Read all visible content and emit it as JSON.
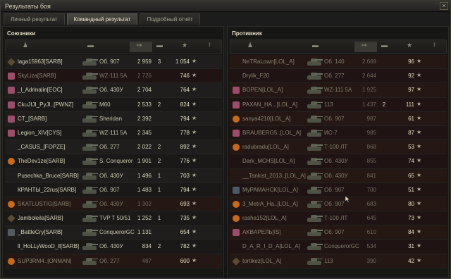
{
  "window": {
    "title": "Результаты боя",
    "close_label": "×"
  },
  "tabs": [
    "Личный результат",
    "Командный результат",
    "Подробный отчёт"
  ],
  "panels": {
    "left": {
      "title": "Союзники",
      "rows": [
        {
          "badge": "diamond",
          "name": "laga15963[SARB]",
          "tank": "Об. 907",
          "damage": "2 959",
          "kills": "3",
          "xp": "1 054",
          "dead": false
        },
        {
          "badge": "pink",
          "name": "SkyLiza[SARB]",
          "tank": "WZ-111 5A",
          "damage": "2 726",
          "kills": "",
          "xp": "746",
          "dead": true
        },
        {
          "badge": "pink",
          "name": "_l_Adrinalin[EOC]",
          "tank": "Об. 430У",
          "damage": "2 704",
          "kills": "",
          "xp": "764",
          "dead": false
        },
        {
          "badge": "pink",
          "name": "CkuJIJI_PyJI..[PWNZ]",
          "tank": "M60",
          "damage": "2 533",
          "kills": "2",
          "xp": "824",
          "dead": false
        },
        {
          "badge": "pink",
          "name": "CT_[SARB]",
          "tank": "Sheridan",
          "damage": "2 392",
          "kills": "",
          "xp": "794",
          "dead": false
        },
        {
          "badge": "pink",
          "name": "Legion_XIV[CYS]",
          "tank": "WZ-111 5A",
          "damage": "2 345",
          "kills": "",
          "xp": "778",
          "dead": false
        },
        {
          "badge": "",
          "name": "_CASUS_[FOPZE]",
          "tank": "Об. 277",
          "damage": "2 022",
          "kills": "2",
          "xp": "892",
          "dead": false
        },
        {
          "badge": "orange",
          "name": "TheDev1ze[SARB]",
          "tank": "S. Conqueror",
          "damage": "1 901",
          "kills": "2",
          "xp": "776",
          "dead": false
        },
        {
          "badge": "",
          "name": "Pusechka_Bruce[SARB]",
          "tank": "Об. 430У",
          "damage": "1 496",
          "kills": "1",
          "xp": "703",
          "dead": false
        },
        {
          "badge": "",
          "name": "КРАНТЫ_22rus[SARB]",
          "tank": "Об. 907",
          "damage": "1 483",
          "kills": "1",
          "xp": "794",
          "dead": false
        },
        {
          "badge": "orange",
          "name": "SKATLUSTIG[SARB]",
          "tank": "Об. 430У",
          "damage": "1 302",
          "kills": "",
          "xp": "693",
          "dead": true
        },
        {
          "badge": "diamond",
          "name": "Jamboleila[SARB]",
          "tank": "TVP T 50/51",
          "damage": "1 252",
          "kills": "1",
          "xp": "735",
          "dead": false
        },
        {
          "badge": "grey",
          "name": "_BattleCry[SARB]",
          "tank": "ConquerorGC",
          "damage": "1 131",
          "kills": "",
          "xp": "654",
          "dead": false
        },
        {
          "badge": "",
          "name": "ll_HoLLyWooD_ll[SARB]",
          "tank": "Об. 430У",
          "damage": "834",
          "kills": "2",
          "xp": "782",
          "dead": false
        },
        {
          "badge": "orange",
          "name": "SUP3RM4..[ONMAN]",
          "tank": "Об. 277",
          "damage": "487",
          "kills": "",
          "xp": "600",
          "dead": true
        }
      ]
    },
    "right": {
      "title": "Противник",
      "rows": [
        {
          "badge": "",
          "name": "NeTRaLown[LOL_A]",
          "tank": "Об. 140",
          "damage": "2 669",
          "kills": "",
          "xp": "96",
          "dead": true
        },
        {
          "badge": "",
          "name": "Drylik_F20",
          "tank": "Об. 277",
          "damage": "2 644",
          "kills": "",
          "xp": "92",
          "dead": true
        },
        {
          "badge": "pink",
          "name": "BOPEN[LOL_A]",
          "tank": "WZ-111 5A",
          "damage": "1 925",
          "kills": "",
          "xp": "97",
          "dead": true
        },
        {
          "badge": "pink",
          "name": "PAXAN_HA...[LOL_A]",
          "tank": "113",
          "damage": "1 437",
          "kills": "2",
          "xp": "111",
          "dead": true
        },
        {
          "badge": "orange",
          "name": "sanya4210[LOL_A]",
          "tank": "Об. 907",
          "damage": "987",
          "kills": "",
          "xp": "61",
          "dead": true
        },
        {
          "badge": "pink",
          "name": "BRAUBERG5..[LOL_A]",
          "tank": "ИС-7",
          "damage": "985",
          "kills": "",
          "xp": "87",
          "dead": true
        },
        {
          "badge": "orange",
          "name": "radubradu[LOL_A]",
          "tank": "Т-100 ЛТ",
          "damage": "868",
          "kills": "",
          "xp": "53",
          "dead": true
        },
        {
          "badge": "",
          "name": "Dark_MCHS[LOL_A]",
          "tank": "Об. 430У",
          "damage": "855",
          "kills": "",
          "xp": "74",
          "dead": true
        },
        {
          "badge": "",
          "name": "__Tankist_2013..[LOL_A]",
          "tank": "Об. 430У",
          "damage": "841",
          "kills": "",
          "xp": "65",
          "dead": true
        },
        {
          "badge": "slate",
          "name": "MyPAMAHCK[LOL_A]",
          "tank": "Об. 907",
          "damage": "700",
          "kills": "",
          "xp": "51",
          "dead": true
        },
        {
          "badge": "orange",
          "name": "3_MetrA_Ha..[LOL_A]",
          "tank": "Об. 907",
          "damage": "683",
          "kills": "",
          "xp": "80",
          "dead": true
        },
        {
          "badge": "orange",
          "name": "rasha152[LOL_A]",
          "tank": "Т-100 ЛТ",
          "damage": "645",
          "kills": "",
          "xp": "73",
          "dead": true
        },
        {
          "badge": "pink",
          "name": "AKBAPEЛЬ[IS]",
          "tank": "Об. 907",
          "damage": "610",
          "kills": "",
          "xp": "84",
          "dead": true
        },
        {
          "badge": "",
          "name": "D_A_R_I_D_A[LOL_A]",
          "tank": "ConquerorGC",
          "damage": "534",
          "kills": "",
          "xp": "31",
          "dead": true
        },
        {
          "badge": "diamond",
          "name": "tortikez[LOL_A]",
          "tank": "113",
          "damage": "390",
          "kills": "",
          "xp": "42",
          "dead": true
        }
      ]
    }
  },
  "header_icons": [
    "player-icon",
    "tank-icon",
    "damage-sort-icon",
    "kills-icon",
    "xp-icon",
    "exclamation-icon"
  ],
  "star_glyph": "★",
  "colors": {
    "accent": "#3b3933",
    "dead_row": "#241714",
    "text": "#d6d0b8"
  }
}
